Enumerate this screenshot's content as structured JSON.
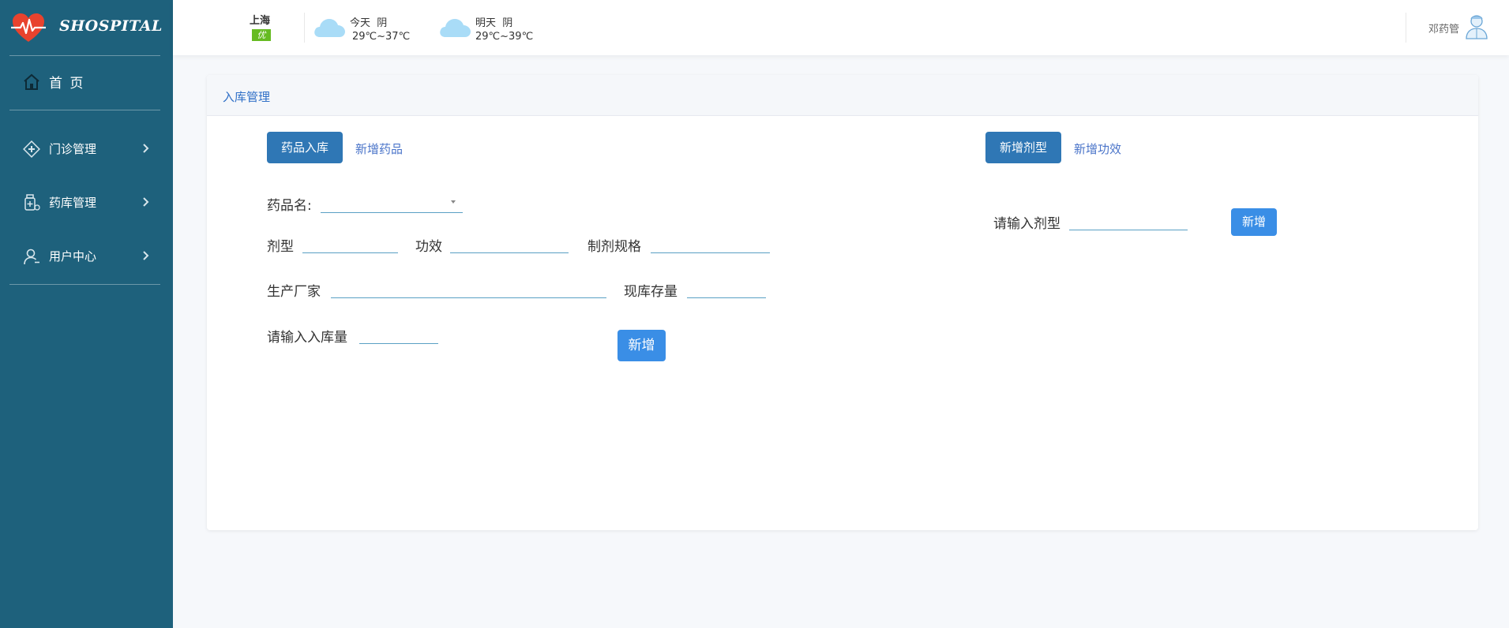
{
  "sidebar": {
    "brand": "SHOSPITAL",
    "items": [
      {
        "label": "首 页",
        "icon": "home-icon"
      },
      {
        "label": "门诊管理",
        "icon": "clinic-icon"
      },
      {
        "label": "药库管理",
        "icon": "pharmacy-icon"
      },
      {
        "label": "用户中心",
        "icon": "user-icon"
      }
    ]
  },
  "header": {
    "city": "上海",
    "air_quality": "优",
    "today": {
      "label": "今天",
      "condition": "阴",
      "temp": "29℃~37℃"
    },
    "tomorrow": {
      "label": "明天",
      "condition": "阴",
      "temp": "29℃~39℃"
    },
    "user": "邓药管"
  },
  "card": {
    "title": "入库管理",
    "left_tabs": {
      "active": "药品入库",
      "link": "新增药品"
    },
    "right_tabs": {
      "active": "新增剂型",
      "link": "新增功效"
    },
    "form": {
      "drug_name": "药品名:",
      "dosage_form": "剂型",
      "efficacy": "功效",
      "specification": "制剂规格",
      "manufacturer": "生产厂家",
      "stock": "现库存量",
      "inbound_qty": "请输入入库量",
      "submit": "新增"
    },
    "right_form": {
      "dosage_input": "请输入剂型",
      "submit": "新增"
    }
  },
  "colors": {
    "sidebar_bg": "#1e617c",
    "primary_button": "#2f77b5",
    "accent_button": "#3a8ee6",
    "link": "#4a74c9",
    "air_quality_badge": "#66bb22"
  }
}
